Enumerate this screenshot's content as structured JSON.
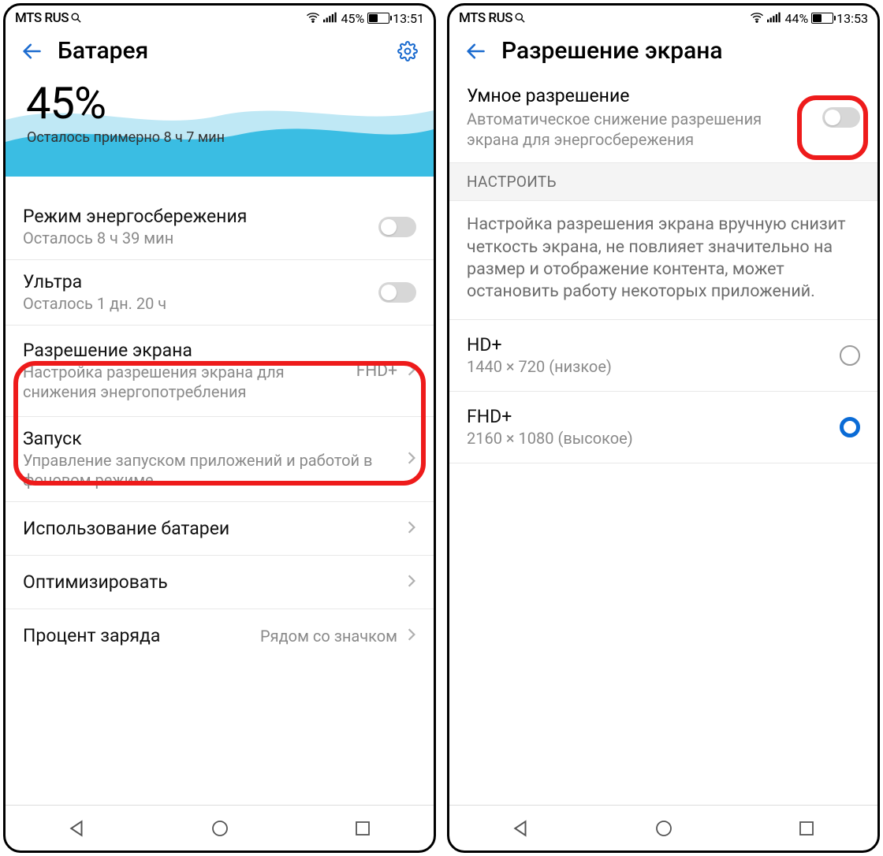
{
  "left": {
    "status": {
      "carrier": "MTS RUS",
      "battery_pct": "45%",
      "time": "13:51",
      "battery_fill_pct": 45
    },
    "header": {
      "title": "Батарея"
    },
    "hero": {
      "pct": "45%",
      "subtitle": "Осталось примерно 8 ч 7 мин"
    },
    "rows": {
      "power_save": {
        "title": "Режим энергосбережения",
        "sub": "Осталось 8 ч 39 мин"
      },
      "ultra": {
        "title": "Ультра",
        "sub": "Осталось 1 дн. 20 ч"
      },
      "resolution": {
        "title": "Разрешение экрана",
        "sub": "Настройка разрешения экрана для снижения энергопотребления",
        "value": "FHD+"
      },
      "startup": {
        "title": "Запуск",
        "sub": "Управление запуском приложений и работой в фоновом режиме"
      },
      "usage": {
        "title": "Использование батареи"
      },
      "optimize": {
        "title": "Оптимизировать"
      },
      "percent": {
        "title": "Процент заряда",
        "value": "Рядом со значком"
      }
    }
  },
  "right": {
    "status": {
      "carrier": "MTS RUS",
      "battery_pct": "44%",
      "time": "13:53",
      "battery_fill_pct": 44
    },
    "header": {
      "title": "Разрешение экрана"
    },
    "smart": {
      "title": "Умное разрешение",
      "sub": "Автоматическое снижение разрешения экрана для энергосбережения"
    },
    "section": {
      "header": "НАСТРОИТЬ",
      "info": "Настройка разрешения экрана вручную снизит четкость экрана, не повлияет значительно на размер и отображение контента, может остановить работу некоторых приложений."
    },
    "options": {
      "hd": {
        "title": "HD+",
        "sub": "1440 × 720 (низкое)",
        "selected": false
      },
      "fhd": {
        "title": "FHD+",
        "sub": "2160 × 1080 (высокое)",
        "selected": true
      }
    }
  }
}
